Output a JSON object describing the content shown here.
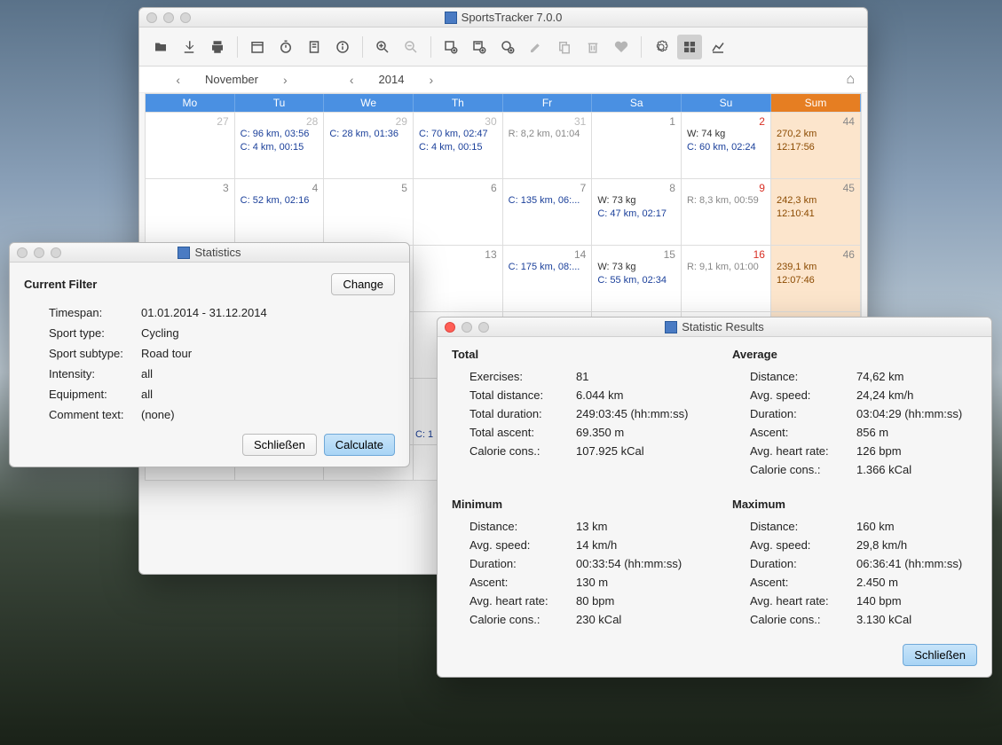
{
  "mainWindow": {
    "title": "SportsTracker 7.0.0"
  },
  "nav": {
    "month": "November",
    "year": "2014"
  },
  "daysOfWeek": [
    "Mo",
    "Tu",
    "We",
    "Th",
    "Fr",
    "Sa",
    "Su",
    "Sum"
  ],
  "cells": {
    "r0c0": {
      "num": "27",
      "gray": true
    },
    "r0c1": {
      "num": "28",
      "e1": "C: 96 km, 03:56",
      "e2": "C: 4 km, 00:15",
      "c": "blue"
    },
    "r0c2": {
      "num": "29",
      "e1": "C: 28 km, 01:36",
      "c": "blue"
    },
    "r0c3": {
      "num": "30",
      "e1": "C: 70 km, 02:47",
      "e2": "C: 4 km, 00:15",
      "c": "blue"
    },
    "r0c4": {
      "num": "31",
      "gray": true,
      "e1": "R: 8,2 km, 01:04",
      "c": "gray"
    },
    "r0c5": {
      "num": "1"
    },
    "r0c6": {
      "num": "2",
      "red": true,
      "e1": "W: 74 kg",
      "e2": "C: 60 km, 02:24",
      "c1": "dark",
      "c2": "blue"
    },
    "r0c7": {
      "num": "44",
      "sum": true,
      "e1": "270,2 km",
      "e2": "12:17:56",
      "c": "orange"
    },
    "r1c0": {
      "num": "3"
    },
    "r1c1": {
      "num": "4",
      "e1": "C: 52 km, 02:16",
      "c": "blue"
    },
    "r1c2": {
      "num": "5"
    },
    "r1c3": {
      "num": "6"
    },
    "r1c4": {
      "num": "7",
      "e1": "C: 135 km, 06:...",
      "c": "blue"
    },
    "r1c5": {
      "num": "8",
      "e1": "W: 73 kg",
      "e2": "C: 47 km, 02:17",
      "c1": "dark",
      "c2": "blue"
    },
    "r1c6": {
      "num": "9",
      "red": true,
      "e1": "R: 8,3 km, 00:59",
      "c": "gray"
    },
    "r1c7": {
      "num": "45",
      "sum": true,
      "e1": "242,3 km",
      "e2": "12:10:41",
      "c": "orange"
    },
    "r2c0": {
      "num": ""
    },
    "r2c1": {
      "num": ""
    },
    "r2c2": {
      "num": ""
    },
    "r2c3": {
      "num": "13"
    },
    "r2c4": {
      "num": "14",
      "e1": "C: 175 km, 08:...",
      "c": "blue"
    },
    "r2c5": {
      "num": "15",
      "e1": "W: 73 kg",
      "e2": "C: 55 km, 02:34",
      "c1": "dark",
      "c2": "blue"
    },
    "r2c6": {
      "num": "16",
      "red": true,
      "e1": "R: 9,1 km, 01:00",
      "c": "gray"
    },
    "r2c7": {
      "num": "46",
      "sum": true,
      "e1": "239,1 km",
      "e2": "12:07:46",
      "c": "orange"
    },
    "r3cvis": {
      "e1": "C: 1",
      "c": "blue"
    }
  },
  "statDlg": {
    "title": "Statistics",
    "header": "Current Filter",
    "change": "Change",
    "rows": {
      "timespan_l": "Timespan:",
      "timespan_v": "01.01.2014 - 31.12.2014",
      "sport_l": "Sport type:",
      "sport_v": "Cycling",
      "sub_l": "Sport subtype:",
      "sub_v": "Road tour",
      "int_l": "Intensity:",
      "int_v": "all",
      "eq_l": "Equipment:",
      "eq_v": "all",
      "cm_l": "Comment text:",
      "cm_v": "(none)"
    },
    "close": "Schließen",
    "calc": "Calculate"
  },
  "resDlg": {
    "title": "Statistic Results",
    "total": "Total",
    "avg": "Average",
    "min": "Minimum",
    "max": "Maximum",
    "t": {
      "ex_l": "Exercises:",
      "ex_v": "81",
      "td_l": "Total distance:",
      "td_v": "6.044 km",
      "du_l": "Total duration:",
      "du_v": "249:03:45 (hh:mm:ss)",
      "as_l": "Total ascent:",
      "as_v": "69.350 m",
      "ca_l": "Calorie cons.:",
      "ca_v": "107.925 kCal"
    },
    "a": {
      "di_l": "Distance:",
      "di_v": "74,62 km",
      "sp_l": "Avg. speed:",
      "sp_v": "24,24 km/h",
      "du_l": "Duration:",
      "du_v": "03:04:29 (hh:mm:ss)",
      "as_l": "Ascent:",
      "as_v": "856 m",
      "hr_l": "Avg. heart rate:",
      "hr_v": "126 bpm",
      "ca_l": "Calorie cons.:",
      "ca_v": "1.366 kCal"
    },
    "mn": {
      "di_l": "Distance:",
      "di_v": "13 km",
      "sp_l": "Avg. speed:",
      "sp_v": "14 km/h",
      "du_l": "Duration:",
      "du_v": "00:33:54 (hh:mm:ss)",
      "as_l": "Ascent:",
      "as_v": "130 m",
      "hr_l": "Avg. heart rate:",
      "hr_v": "80 bpm",
      "ca_l": "Calorie cons.:",
      "ca_v": "230 kCal"
    },
    "mx": {
      "di_l": "Distance:",
      "di_v": "160 km",
      "sp_l": "Avg. speed:",
      "sp_v": "29,8 km/h",
      "du_l": "Duration:",
      "du_v": "06:36:41 (hh:mm:ss)",
      "as_l": "Ascent:",
      "as_v": "2.450 m",
      "hr_l": "Avg. heart rate:",
      "hr_v": "140 bpm",
      "ca_l": "Calorie cons.:",
      "ca_v": "3.130 kCal"
    },
    "close": "Schließen"
  }
}
